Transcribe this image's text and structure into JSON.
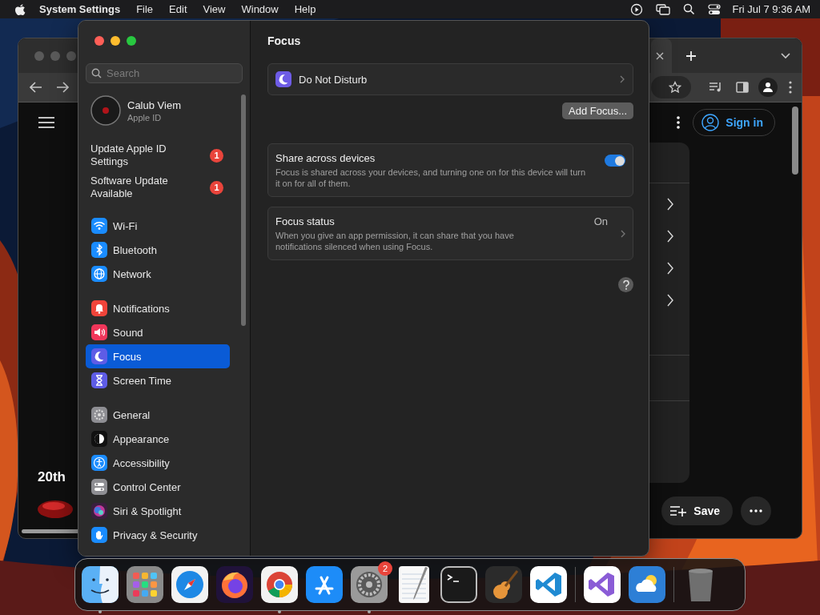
{
  "menubar": {
    "app": "System Settings",
    "menus": [
      "File",
      "Edit",
      "View",
      "Window",
      "Help"
    ],
    "clock": "Fri Jul 7  9:36 AM"
  },
  "browser": {
    "heading": "20th",
    "sign_in": "Sign in",
    "save": "Save"
  },
  "settings": {
    "search": {
      "placeholder": "Search"
    },
    "account": {
      "name": "Calub Viem",
      "subtitle": "Apple ID"
    },
    "alerts": [
      {
        "label": "Update Apple ID Settings",
        "badge": "1"
      },
      {
        "label": "Software Update Available",
        "badge": "1"
      }
    ],
    "sidebar_groups": [
      {
        "items": [
          {
            "label": "Wi-Fi",
            "kind": "wifi",
            "selected": false
          },
          {
            "label": "Bluetooth",
            "kind": "bluetooth",
            "selected": false
          },
          {
            "label": "Network",
            "kind": "globe",
            "selected": false
          }
        ]
      },
      {
        "items": [
          {
            "label": "Notifications",
            "kind": "bell",
            "selected": false
          },
          {
            "label": "Sound",
            "kind": "speaker",
            "selected": false
          },
          {
            "label": "Focus",
            "kind": "moon",
            "selected": true
          },
          {
            "label": "Screen Time",
            "kind": "hourglass",
            "selected": false
          }
        ]
      },
      {
        "items": [
          {
            "label": "General",
            "kind": "gear",
            "selected": false
          },
          {
            "label": "Appearance",
            "kind": "appearance",
            "selected": false
          },
          {
            "label": "Accessibility",
            "kind": "accessibility",
            "selected": false
          },
          {
            "label": "Control Center",
            "kind": "toggles",
            "selected": false
          },
          {
            "label": "Siri & Spotlight",
            "kind": "siri",
            "selected": false
          },
          {
            "label": "Privacy & Security",
            "kind": "hand",
            "selected": false
          }
        ]
      }
    ],
    "title": "Focus",
    "focus_modes": [
      {
        "label": "Do Not Disturb"
      }
    ],
    "add_button": "Add Focus...",
    "share": {
      "title": "Share across devices",
      "description": "Focus is shared across your devices, and turning one on for this device will turn it on for all of them.",
      "on": true
    },
    "status": {
      "title": "Focus status",
      "description": "When you give an app permission, it can share that you have notifications silenced when using Focus.",
      "value": "On"
    }
  },
  "dock": [
    {
      "kind": "finder",
      "running": true
    },
    {
      "kind": "launchpad",
      "running": false
    },
    {
      "kind": "safari",
      "running": false
    },
    {
      "kind": "firefox",
      "running": false
    },
    {
      "kind": "chrome",
      "running": true
    },
    {
      "kind": "appstore",
      "running": false
    },
    {
      "kind": "settings",
      "running": true,
      "badge": "2"
    },
    {
      "kind": "textedit",
      "running": false
    },
    {
      "kind": "terminal",
      "running": false
    },
    {
      "kind": "garageband",
      "running": false
    },
    {
      "kind": "vscode",
      "running": false
    },
    {
      "kind": "separator"
    },
    {
      "kind": "visualstudio",
      "running": false
    },
    {
      "kind": "weather",
      "running": false
    },
    {
      "kind": "separator"
    },
    {
      "kind": "trash",
      "running": false
    }
  ]
}
